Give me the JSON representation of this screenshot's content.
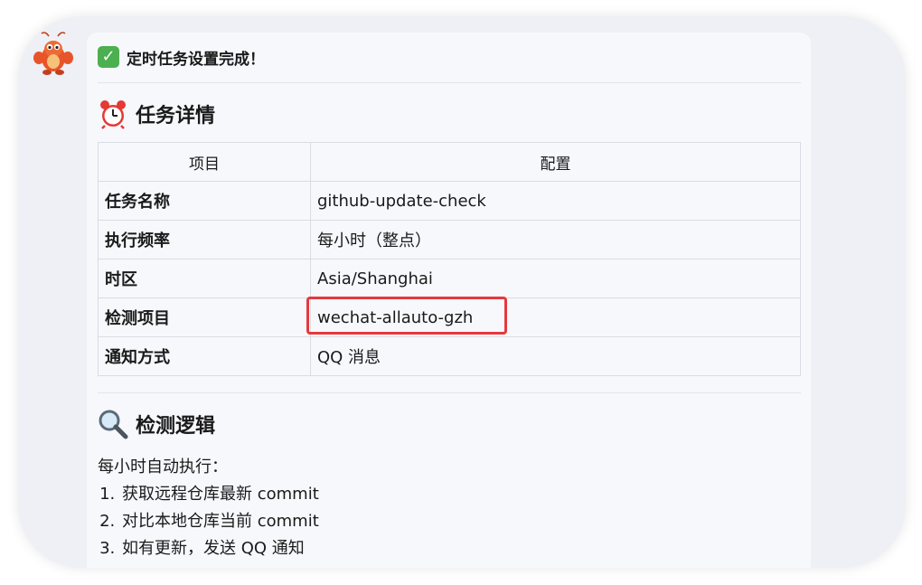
{
  "message": {
    "header_text": "定时任务设置完成！",
    "sections": {
      "details_title": "任务详情",
      "logic_title": "检测逻辑"
    },
    "table": {
      "headers": [
        "项目",
        "配置"
      ],
      "rows": [
        {
          "key": "任务名称",
          "value": "github-update-check"
        },
        {
          "key": "执行频率",
          "value": "每小时（整点）"
        },
        {
          "key": "时区",
          "value": "Asia/Shanghai"
        },
        {
          "key": "检测项目",
          "value": "wechat-allauto-gzh"
        },
        {
          "key": "通知方式",
          "value": "QQ 消息"
        }
      ]
    },
    "logic": {
      "intro": "每小时自动执行：",
      "steps": [
        "获取远程仓库最新 commit",
        "对比本地仓库当前 commit",
        "如有更新，发送 QQ 通知"
      ]
    }
  },
  "colors": {
    "highlight_border": "#e5393d",
    "check_green": "#4caf50"
  },
  "icons": {
    "avatar": "lobster-mascot-avatar",
    "header": "check-mark-icon",
    "details": "alarm-clock-icon",
    "logic": "magnifier-icon"
  }
}
